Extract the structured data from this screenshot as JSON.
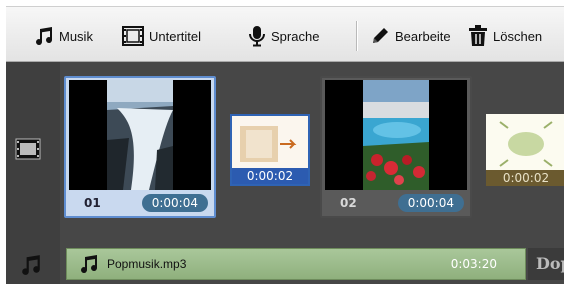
{
  "toolbar": {
    "music_label": "Musik",
    "subtitle_label": "Untertitel",
    "voice_label": "Sprache",
    "edit_label": "Bearbeite",
    "delete_label": "Löschen"
  },
  "timeline": {
    "clips": [
      {
        "number": "01",
        "duration": "0:00:04",
        "selected": true
      },
      {
        "number": "02",
        "duration": "0:00:04",
        "selected": false
      }
    ],
    "transitions": [
      {
        "duration": "0:00:02",
        "selected": true
      },
      {
        "duration": "0:00:02",
        "selected": false
      }
    ]
  },
  "music_track": {
    "file_name": "Popmusik.mp3",
    "duration": "0:03:20",
    "next_clip_partial": "Dop"
  },
  "icons": {
    "music": "music-note-icon",
    "subtitle": "film-strip-icon",
    "voice": "microphone-icon",
    "edit": "pencil-icon",
    "delete": "trash-icon",
    "video_track": "film-strip-icon",
    "music_track": "music-note-icon"
  },
  "colors": {
    "selection": "#5f8dd0",
    "duration_badge": "#3f6f92",
    "music_clip": "#a9c79a"
  }
}
